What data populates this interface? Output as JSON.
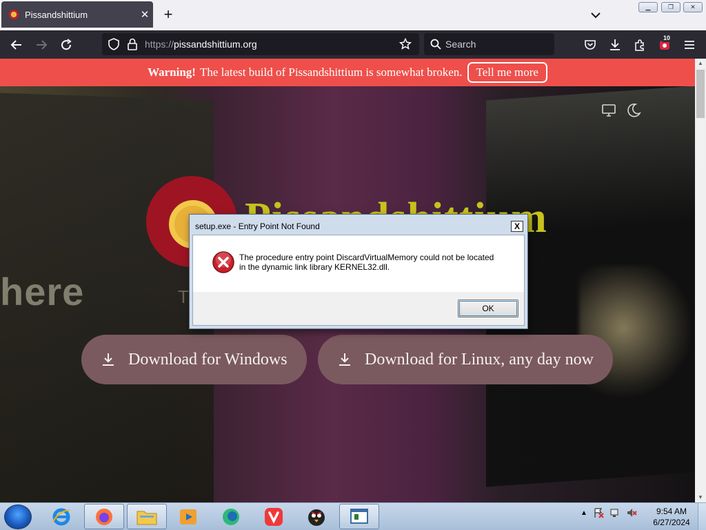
{
  "browser": {
    "tab_title": "Pissandshittium",
    "url_scheme": "https://",
    "url_host": "pissandshittium.org",
    "search_placeholder": "Search",
    "extensions_badge": "10"
  },
  "banner": {
    "warning_label": "Warning!",
    "message": "The latest build of Pissandshittium is somewhat broken.",
    "link_label": "Tell me more"
  },
  "page": {
    "logo_text": "Pissandshittium",
    "background_text_here": "here",
    "background_text_t": "T",
    "download_windows": "Download for Windows",
    "download_linux": "Download for Linux, any day now"
  },
  "dialog": {
    "title": "setup.exe - Entry Point Not Found",
    "message_line1": "The procedure entry point DiscardVirtualMemory could not be located",
    "message_line2": "in the dynamic link library KERNEL32.dll.",
    "ok_label": "OK",
    "close_label": "X"
  },
  "taskbar": {
    "time": "9:54 AM",
    "date": "6/27/2024"
  },
  "colors": {
    "banner": "#ef4f4b",
    "download_button": "#7b5a5f",
    "logo_red": "#9e1423",
    "logo_yellow": "#c7c21d"
  }
}
